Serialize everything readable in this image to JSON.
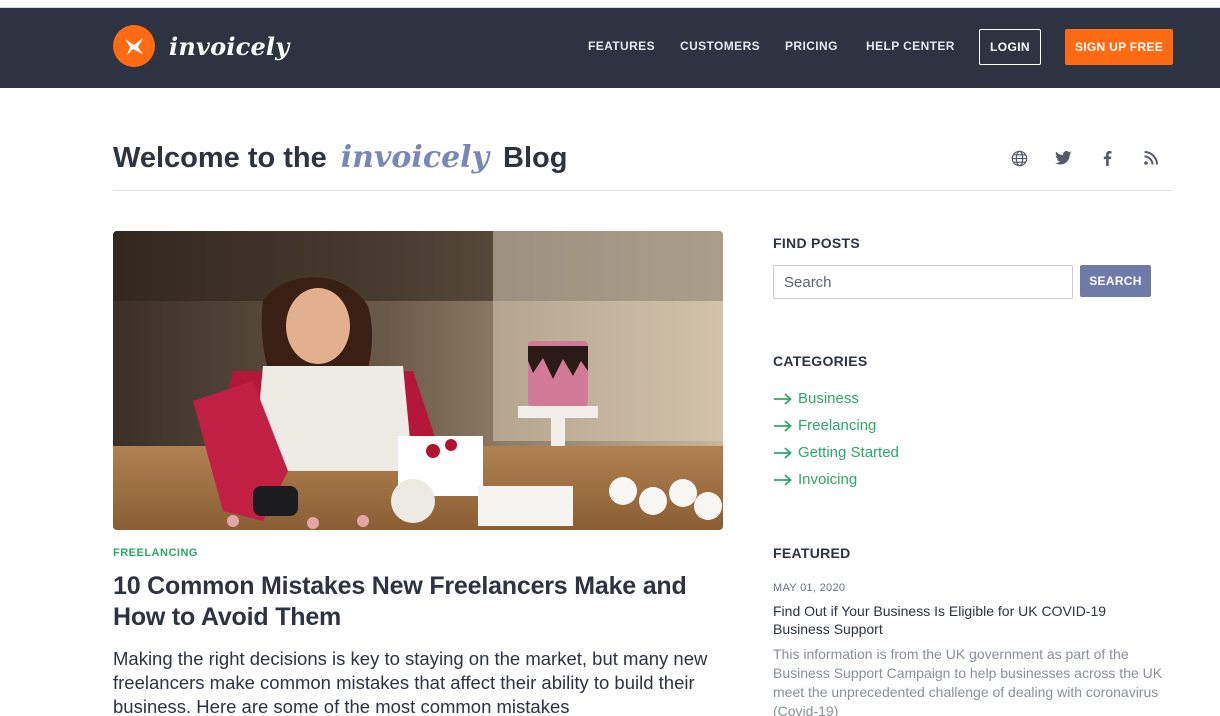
{
  "header": {
    "logo_text": "invoicely",
    "nav": [
      {
        "label": "FEATURES"
      },
      {
        "label": "CUSTOMERS"
      },
      {
        "label": "PRICING"
      },
      {
        "label": "HELP CENTER"
      }
    ],
    "login_label": "LOGIN",
    "signup_label": "SIGN UP FREE",
    "colors": {
      "nav_bg": "#2d3340",
      "accent": "#ff6a13"
    }
  },
  "blog_header": {
    "title_prefix": "Welcome to the",
    "title_brand": "invoicely",
    "title_suffix": "Blog",
    "social_icons": [
      "globe-icon",
      "twitter-icon",
      "facebook-icon",
      "rss-icon"
    ]
  },
  "main_post": {
    "image_icon": "baker-decorating-cake-photo",
    "category": "FREELANCING",
    "title": "10 Common Mistakes New Freelancers Make and How to Avoid Them",
    "excerpt": "Making the right decisions is key to staying on the market, but many new freelancers make common mistakes that affect their ability to build their business. Here are some of the most common mistakes"
  },
  "sidebar": {
    "find_posts": {
      "heading": "FIND POSTS",
      "search_placeholder": "Search",
      "search_button": "SEARCH"
    },
    "categories": {
      "heading": "CATEGORIES",
      "items": [
        {
          "label": "Business"
        },
        {
          "label": "Freelancing"
        },
        {
          "label": "Getting Started"
        },
        {
          "label": "Invoicing"
        }
      ],
      "link_color": "#2ca86a"
    },
    "featured": {
      "heading": "FEATURED",
      "date": "MAY 01, 2020",
      "title": "Find Out if Your Business Is Eligible for UK COVID-19 Business Support",
      "body": "This information is from the UK government as part of the Business Support Campaign to help businesses across the UK meet the unprecedented challenge of dealing with coronavirus (Covid-19)"
    }
  }
}
